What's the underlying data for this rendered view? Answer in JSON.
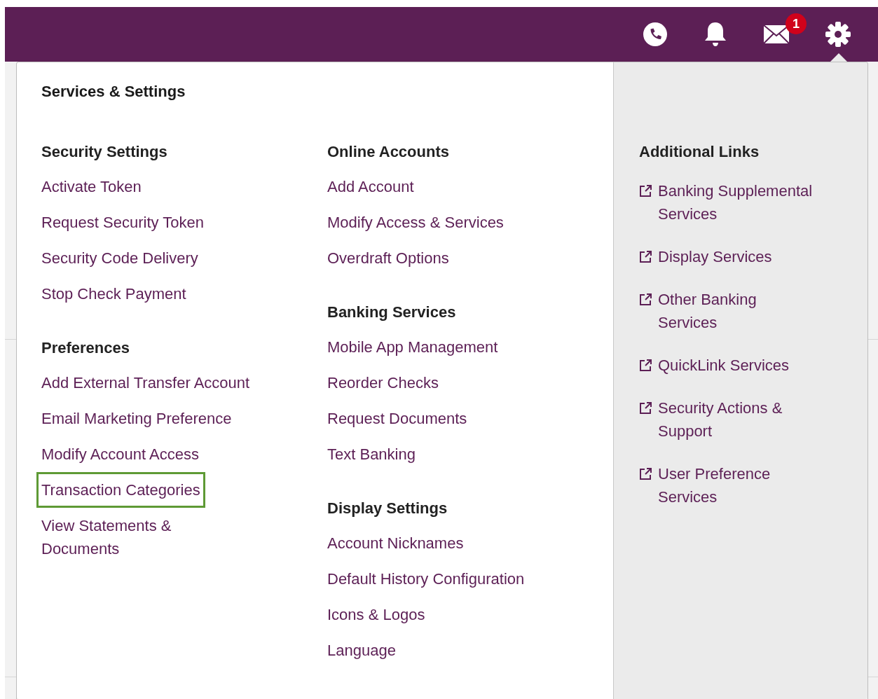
{
  "header": {
    "mail_badge": "1"
  },
  "panel": {
    "title": "Services & Settings",
    "columns": [
      {
        "sections": [
          {
            "heading": "Security Settings",
            "links": [
              {
                "label": "Activate Token",
                "focused": false
              },
              {
                "label": "Request Security Token",
                "focused": false
              },
              {
                "label": "Security Code Delivery",
                "focused": false
              },
              {
                "label": "Stop Check Payment",
                "focused": false
              }
            ]
          },
          {
            "heading": "Preferences",
            "links": [
              {
                "label": "Add External Transfer Account",
                "focused": false
              },
              {
                "label": "Email Marketing Preference",
                "focused": false
              },
              {
                "label": "Modify Account Access",
                "focused": false
              },
              {
                "label": "Transaction Categories",
                "focused": true
              },
              {
                "label": "View Statements &\nDocuments",
                "focused": false
              }
            ]
          }
        ]
      },
      {
        "sections": [
          {
            "heading": "Online Accounts",
            "links": [
              {
                "label": "Add Account",
                "focused": false
              },
              {
                "label": "Modify Access & Services",
                "focused": false
              },
              {
                "label": "Overdraft Options",
                "focused": false
              }
            ]
          },
          {
            "heading": "Banking Services",
            "links": [
              {
                "label": "Mobile App Management",
                "focused": false
              },
              {
                "label": "Reorder Checks",
                "focused": false
              },
              {
                "label": "Request Documents",
                "focused": false
              },
              {
                "label": "Text Banking",
                "focused": false
              }
            ]
          },
          {
            "heading": "Display Settings",
            "links": [
              {
                "label": "Account Nicknames",
                "focused": false
              },
              {
                "label": "Default History Configuration",
                "focused": false
              },
              {
                "label": "Icons & Logos",
                "focused": false
              },
              {
                "label": "Language",
                "focused": false
              }
            ]
          }
        ]
      }
    ],
    "additional": {
      "heading": "Additional Links",
      "links": [
        {
          "label": "Banking Supplemental\nServices"
        },
        {
          "label": "Display Services"
        },
        {
          "label": "Other Banking\nServices"
        },
        {
          "label": "QuickLink Services"
        },
        {
          "label": "Security Actions &\nSupport"
        },
        {
          "label": "User Preference\nServices"
        }
      ]
    }
  }
}
